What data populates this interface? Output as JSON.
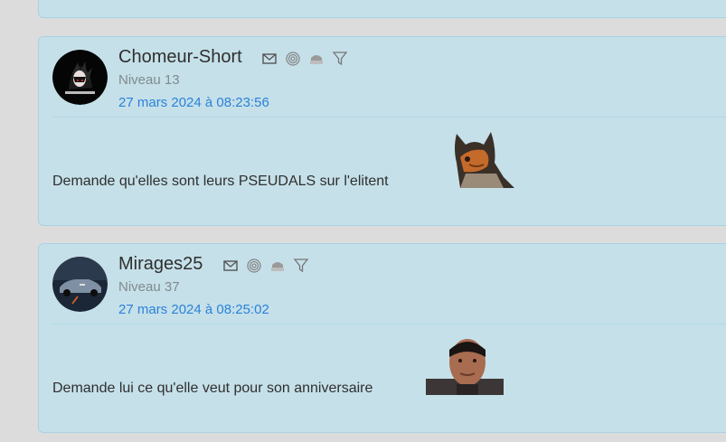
{
  "posts": [
    {
      "username": "Chomeur-Short",
      "level": "Niveau 13",
      "date": "27 mars 2024 à 08:23:56",
      "message": "Demande qu'elles sont leurs PSEUDALS sur l'elitent",
      "avatar": "dark-anime-avatar",
      "sticker": "owl-sticker"
    },
    {
      "username": "Mirages25",
      "level": "Niveau 37",
      "date": "27 mars 2024 à 08:25:02",
      "message": "Demande lui ce qu'elle veut pour son anniversaire",
      "avatar": "night-car-avatar",
      "sticker": "man-face-sticker"
    }
  ],
  "icons": [
    "mail-icon",
    "spiral-icon",
    "badge-icon",
    "filter-icon"
  ],
  "colors": {
    "page_bg": "#dcdcdc",
    "post_bg": "#c5e0e9",
    "post_border": "#a8d2e2",
    "date_link": "#2b82d9",
    "level_text": "#808a8e"
  }
}
